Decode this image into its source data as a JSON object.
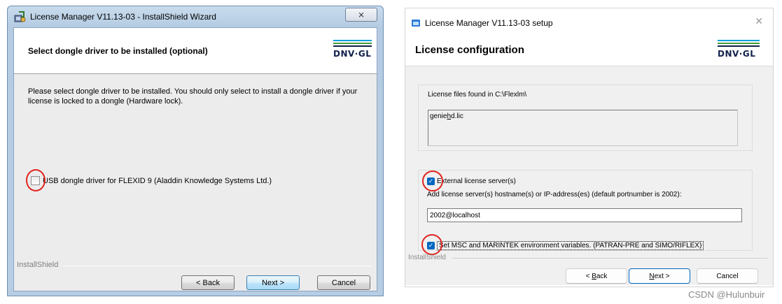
{
  "left_window": {
    "title": "License Manager V11.13-03 - InstallShield Wizard",
    "close_symbol": "⨯",
    "header_title": "Select dongle driver to be installed (optional)",
    "logo_text": "DNV·GL",
    "description": "Please select dongle driver to be installed. You should only select to install a dongle driver if your license is locked to a dongle (Hardware lock).",
    "checkbox_label": "USB dongle driver  for FLEXID 9 (Aladdin Knowledge Systems Ltd.)",
    "footer_brand": "InstallShield",
    "back_button": "< Back",
    "next_button": "Next >",
    "cancel_button": "Cancel"
  },
  "right_window": {
    "title": "License Manager V11.13-03 setup",
    "close_symbol": "✕",
    "heading": "License configuration",
    "logo_text": "DNV·GL",
    "license_files_label": "License files found in C:\\Flexlm\\",
    "license_file_prefix": "genie",
    "license_file_underlined": "h",
    "license_file_suffix": "d.lic",
    "external_server_label": "External license server(s)",
    "server_hint": "Add license server(s) hostname(s) or IP-address(es) (default portnumber is 2002):",
    "server_value": "2002@localhost",
    "env_vars_label": "Set MSC and MARINTEK environment variables. (PATRAN-PRE and SIMO/RIFLEX)",
    "footer_brand": "InstallShield",
    "back_button_prefix": "< ",
    "back_button_key": "B",
    "back_button_rest": "ack",
    "next_button_key": "N",
    "next_button_rest": "ext >",
    "cancel_button": "Cancel"
  },
  "watermark": "CSDN @Hulunbuir",
  "colors": {
    "annotation_red": "#e0251f",
    "checkbox_blue": "#0067c0",
    "logo_navy": "#0f204b",
    "logo_teal": "#009fda",
    "logo_green": "#3f9c35"
  }
}
